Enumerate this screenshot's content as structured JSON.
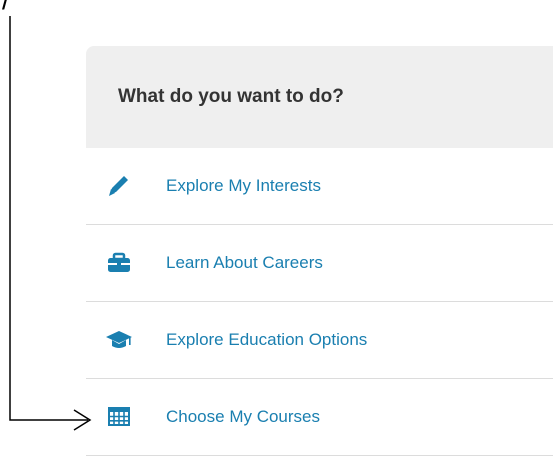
{
  "callout": {
    "top_glyph": "/"
  },
  "panel": {
    "title": "What do you want to do?",
    "items": [
      {
        "label": "Explore My Interests",
        "icon": "pencil-icon"
      },
      {
        "label": "Learn About Careers",
        "icon": "briefcase-icon"
      },
      {
        "label": "Explore Education Options",
        "icon": "graduation-cap-icon"
      },
      {
        "label": "Choose My Courses",
        "icon": "calendar-grid-icon"
      }
    ]
  },
  "colors": {
    "header_bg": "#efefef",
    "title": "#333333",
    "link": "#1a7fb0",
    "icon": "#1a7fb0",
    "divider": "#dcdcdc"
  }
}
